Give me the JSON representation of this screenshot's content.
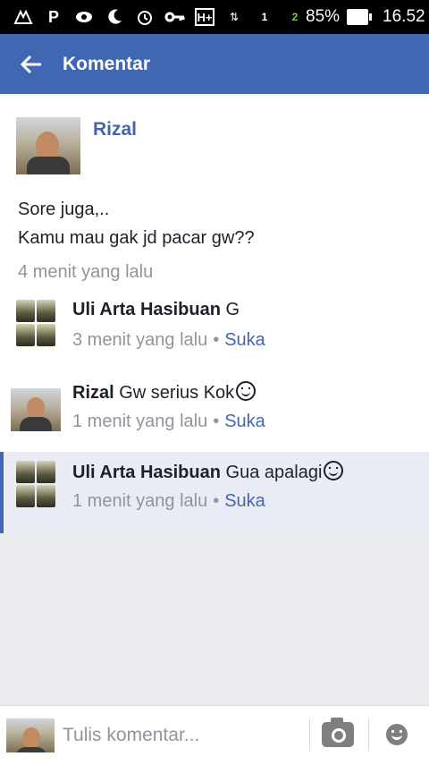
{
  "status_bar": {
    "icons": [
      "notification-icon",
      "parking-icon",
      "eye-icon",
      "moon-icon",
      "alarm-icon",
      "key-icon",
      "hplus-icon",
      "data-arrows-icon",
      "signal-icon"
    ],
    "sim1": "1",
    "sim2": "2",
    "battery": "85%",
    "time": "16.52"
  },
  "app_bar": {
    "back_icon": "arrow-left-icon",
    "title": "Komentar"
  },
  "post": {
    "author": "Rizal",
    "line1": "Sore juga,..",
    "line2": "Kamu mau gak jd pacar gw??",
    "time": "4 menit yang lalu"
  },
  "comments": [
    {
      "name": "Uli Arta Hasibuan",
      "text": "G",
      "time": "3 menit yang lalu",
      "like": "Suka"
    },
    {
      "name": "Rizal",
      "text": "Gw serius Kok",
      "time": "1 menit yang lalu",
      "like": "Suka"
    },
    {
      "name": "Uli Arta Hasibuan",
      "text": "Gua apalagi",
      "time": "1 menit yang lalu",
      "like": "Suka"
    }
  ],
  "composer": {
    "placeholder": "Tulis komentar...",
    "camera_icon": "camera-icon",
    "emoji_icon": "smiley-icon"
  },
  "colors": {
    "brand": "#4267b2",
    "muted": "#90949c",
    "highlight": "#e9ecf4"
  }
}
